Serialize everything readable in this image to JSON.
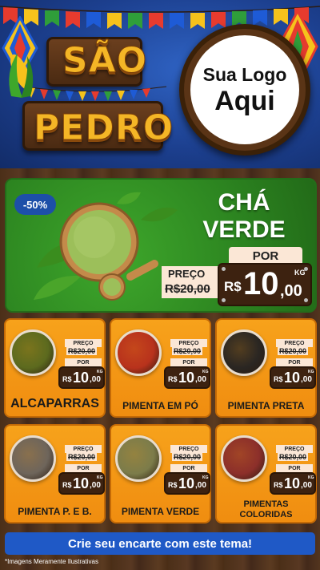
{
  "brand": {
    "title_line1": "SÃO",
    "title_line2": "PEDRO",
    "logo_line1": "Sua Logo",
    "logo_line2": "Aqui"
  },
  "hero": {
    "discount": "-50%",
    "title_line1": "CHÁ",
    "title_line2": "VERDE",
    "price_label": "PREÇO",
    "old_price": "R$20,00",
    "por_label": "POR",
    "currency": "R$",
    "price_int": "10",
    "price_cents": ",00",
    "unit": "KG"
  },
  "products": [
    {
      "name": "ALCAPARRAS",
      "price_label": "PREÇO",
      "old_price": "R$20,00",
      "por_label": "POR",
      "currency": "R$",
      "price_int": "10",
      "price_cents": ",00",
      "unit": "KG",
      "color": "#5c6a1e"
    },
    {
      "name": "PIMENTA EM PÓ",
      "price_label": "PREÇO",
      "old_price": "R$20,00",
      "por_label": "POR",
      "currency": "R$",
      "price_int": "10",
      "price_cents": ",00",
      "unit": "KG",
      "color": "#b8321c"
    },
    {
      "name": "PIMENTA PRETA",
      "price_label": "PREÇO",
      "old_price": "R$20,00",
      "por_label": "POR",
      "currency": "R$",
      "price_int": "10",
      "price_cents": ",00",
      "unit": "KG",
      "color": "#2a2622"
    },
    {
      "name": "PIMENTA P. E B.",
      "price_label": "PREÇO",
      "old_price": "R$20,00",
      "por_label": "POR",
      "currency": "R$",
      "price_int": "10",
      "price_cents": ",00",
      "unit": "KG",
      "color": "#6e655b"
    },
    {
      "name": "PIMENTA VERDE",
      "price_label": "PREÇO",
      "old_price": "R$20,00",
      "por_label": "POR",
      "currency": "R$",
      "price_int": "10",
      "price_cents": ",00",
      "unit": "KG",
      "color": "#7c7c4a"
    },
    {
      "name_line1": "PIMENTAS",
      "name_line2": "COLORIDAS",
      "price_label": "PREÇO",
      "old_price": "R$20,00",
      "por_label": "POR",
      "currency": "R$",
      "price_int": "10",
      "price_cents": ",00",
      "unit": "KG",
      "color": "#8c2f2a"
    }
  ],
  "footer": {
    "cta": "Crie seu encarte com este tema!",
    "disclaimer": "*Imagens Meramente Ilustrativas"
  },
  "colors": {
    "header_blue": "#1c3f8e",
    "hero_green": "#2f8a22",
    "card_orange": "#f7a21b",
    "cta_blue": "#1f59c6",
    "title_gold": "#f4b626"
  }
}
